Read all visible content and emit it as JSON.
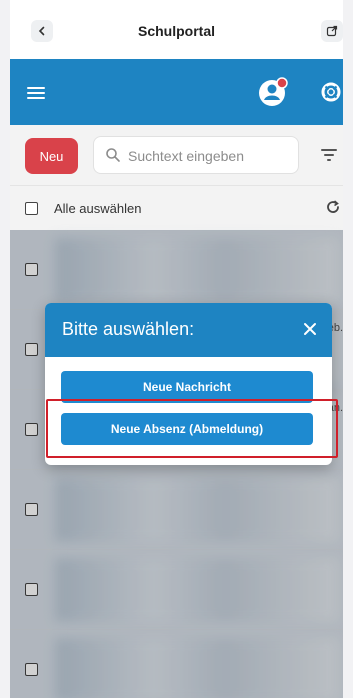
{
  "browser": {
    "title": "Schulportal"
  },
  "app": {},
  "toolbar": {
    "new_label": "Neu",
    "search_placeholder": "Suchtext eingeben"
  },
  "select_all": {
    "label": "Alle auswählen"
  },
  "list": {
    "rows": [
      {
        "date": ""
      },
      {
        "date": "Feb."
      },
      {
        "date": "Jan."
      },
      {
        "date": ""
      },
      {
        "date": ""
      },
      {
        "date": ""
      }
    ]
  },
  "modal": {
    "title": "Bitte auswählen:",
    "options": [
      {
        "label": "Neue Nachricht"
      },
      {
        "label": "Neue Absenz (Abmeldung)"
      }
    ]
  },
  "colors": {
    "primary": "#1e84c2",
    "new_button": "#d9424a",
    "highlight": "#d01f2a"
  }
}
